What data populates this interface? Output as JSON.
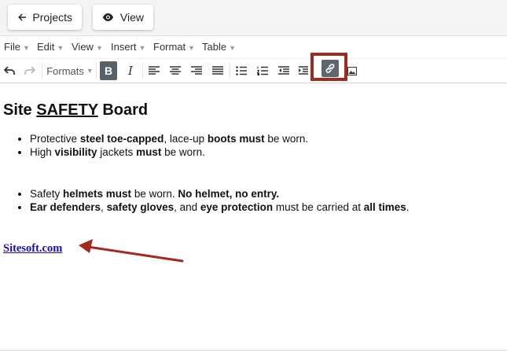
{
  "topbar": {
    "projects_label": "Projects",
    "view_label": "View"
  },
  "menubar": {
    "items": [
      {
        "label": "File"
      },
      {
        "label": "Edit"
      },
      {
        "label": "View"
      },
      {
        "label": "Insert"
      },
      {
        "label": "Format"
      },
      {
        "label": "Table"
      }
    ]
  },
  "toolbar": {
    "formats_label": "Formats",
    "bold_label": "B",
    "italic_label": "I",
    "icons": [
      "undo-icon",
      "redo-icon",
      "align-left-icon",
      "align-center-icon",
      "align-right-icon",
      "align-justify-icon",
      "bullet-list-icon",
      "numbered-list-icon",
      "outdent-icon",
      "indent-icon",
      "link-icon",
      "image-icon"
    ]
  },
  "document": {
    "title_prefix": "Site ",
    "title_underlined": "SAFETY",
    "title_suffix": " Board",
    "list1": [
      {
        "p1": "Protective ",
        "b1": "steel toe-capped",
        "p2": ", lace-up ",
        "b2": "boots must",
        "p3": " be worn."
      },
      {
        "p1": "High ",
        "b1": "visibility",
        "p2": " jackets ",
        "b2": "must",
        "p3": " be worn."
      }
    ],
    "list2": [
      {
        "p1": "Safety ",
        "b1": "helmets must",
        "p2": " be worn. ",
        "b2": "No helmet, no entry.",
        "p3": ""
      },
      {
        "p1": "",
        "b1": "Ear defenders",
        "p2": ", ",
        "b2": "safety gloves",
        "p3": ", and ",
        "b3": "eye protection",
        "p4": " must be carried at ",
        "b4": "all times",
        "p5": "."
      }
    ],
    "link_text": "Sitesoft.com"
  },
  "colors": {
    "highlight_box": "#9b2c1f",
    "arrow": "#a3291f",
    "link": "#1a0dab",
    "active_button": "#58606a"
  }
}
